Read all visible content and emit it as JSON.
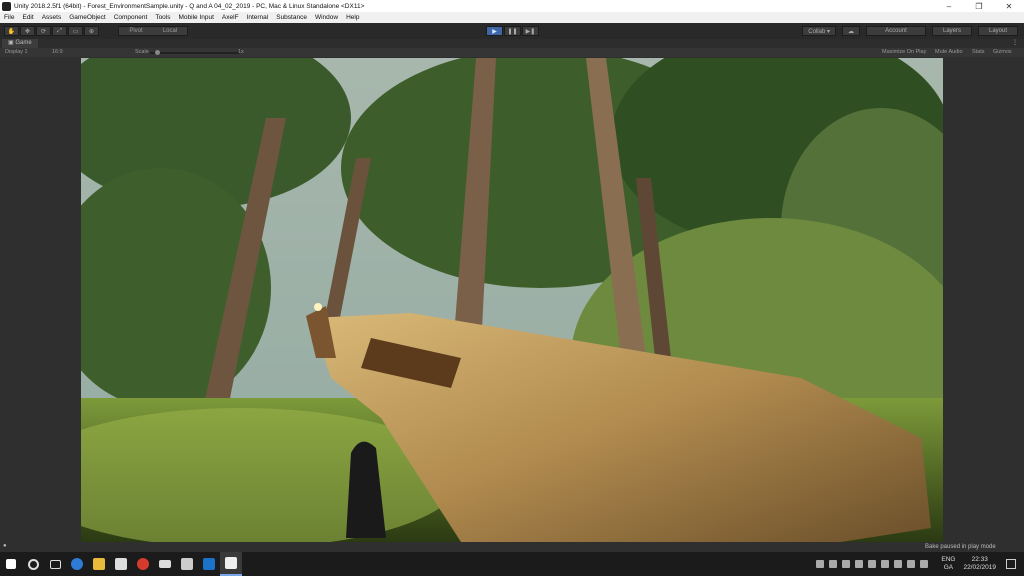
{
  "window": {
    "title": "Unity 2018.2.5f1 (64bit) - Forest_EnvironmentSample.unity - Q and A 04_02_2019 - PC, Mac & Linux Standalone <DX11>",
    "controls": [
      "–",
      "❐",
      "✕"
    ]
  },
  "menu": [
    "File",
    "Edit",
    "Assets",
    "GameObject",
    "Component",
    "Tools",
    "Mobile Input",
    "AxelF",
    "Internal",
    "Substance",
    "Window",
    "Help"
  ],
  "toolbar": {
    "pivot": "Pivot",
    "local": "Local",
    "collab": "Collab ▾",
    "account": "Account",
    "layers": "Layers",
    "layout": "Layout"
  },
  "game": {
    "tab": "Game",
    "display": "Display 1",
    "aspect": "16:9",
    "scale_label": "Scale",
    "scale_value": "1x",
    "maximize": "Maximize On Play",
    "mute": "Mute Audio",
    "stats": "Stats",
    "gizmos": "Gizmos"
  },
  "status": {
    "message": "Bake paused in play mode"
  },
  "taskbar": {
    "lang": "ENG",
    "region": "GA",
    "time": "22:33",
    "date": "22/02/2019"
  },
  "colors": {
    "play_active": "#3f67a8",
    "taskbar": "#1b1b1b",
    "editor": "#464646"
  }
}
